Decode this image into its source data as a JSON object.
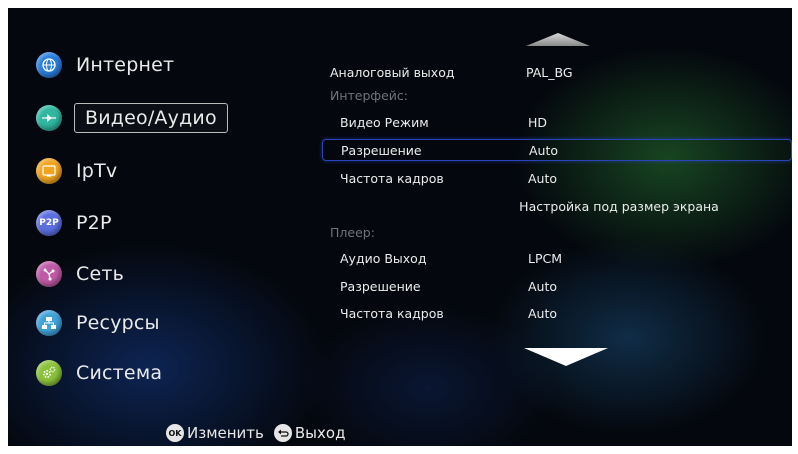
{
  "menu": {
    "items": [
      {
        "label": "Интернет",
        "icon": "globe-icon",
        "color": "#2a7de0"
      },
      {
        "label": "Видео/Аудио",
        "icon": "play-icon",
        "color": "#2fb7a0"
      },
      {
        "label": "IpTv",
        "icon": "tv-icon",
        "color": "#f0a51e"
      },
      {
        "label": "P2P",
        "icon": "p2p-icon",
        "color": "#5b6fe0",
        "icon_text": "P2P"
      },
      {
        "label": "Сеть",
        "icon": "network-icon",
        "color": "#c05aa6"
      },
      {
        "label": "Ресурсы",
        "icon": "resources-icon",
        "color": "#3fa2d8"
      },
      {
        "label": "Система",
        "icon": "gears-icon",
        "color": "#8bc23a"
      }
    ],
    "selected_index": 1
  },
  "settings": {
    "top": {
      "key": "Аналоговый выход",
      "value": "PAL_BG"
    },
    "interface_header": "Интерфейс:",
    "interface_rows": [
      {
        "key": "Видео Режим",
        "value": "HD"
      },
      {
        "key": "Разрешение",
        "value": "Auto"
      },
      {
        "key": "Частота кадров",
        "value": "Auto"
      }
    ],
    "screen_fit": "Настройка под размер экрана",
    "player_header": "Плеер:",
    "player_rows": [
      {
        "key": "Аудио Выход",
        "value": "LPCM"
      },
      {
        "key": "Разрешение",
        "value": "Auto"
      },
      {
        "key": "Частота кадров",
        "value": "Auto"
      }
    ]
  },
  "bottom": {
    "ok_icon_text": "OK",
    "ok_label": "Изменить",
    "back_label": "Выход"
  }
}
